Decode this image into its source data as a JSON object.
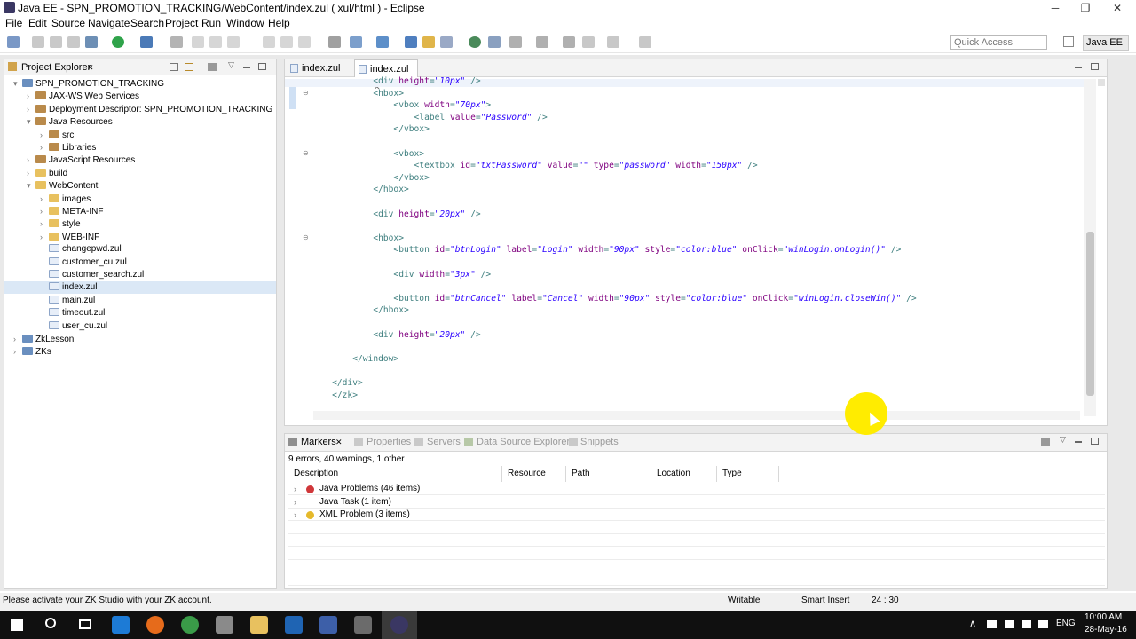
{
  "window": {
    "title": "Java EE - SPN_PROMOTION_TRACKING/WebContent/index.zul ( xul/html ) - Eclipse",
    "min": "─",
    "max": "❐",
    "close": "✕"
  },
  "menu": [
    "File",
    "Edit",
    "Source",
    "Navigate",
    "Search",
    "Project",
    "Run",
    "Window",
    "Help"
  ],
  "toolbar": {
    "quick_access_placeholder": "Quick Access",
    "perspective_label": "Java EE"
  },
  "project_explorer": {
    "tab_label": "Project Explorer",
    "close": "✕",
    "items": [
      {
        "label": "SPN_PROMOTION_TRACKING",
        "icon": "project-icon",
        "arrow": "▾"
      },
      {
        "label": "JAX-WS Web Services",
        "icon": "package-icon",
        "arrow": "›"
      },
      {
        "label": "Deployment Descriptor: SPN_PROMOTION_TRACKING",
        "icon": "package-icon",
        "arrow": "›"
      },
      {
        "label": "Java Resources",
        "icon": "package-icon",
        "arrow": "▾"
      },
      {
        "label": "src",
        "icon": "package-icon",
        "arrow": "›"
      },
      {
        "label": "Libraries",
        "icon": "package-icon",
        "arrow": "›"
      },
      {
        "label": "JavaScript Resources",
        "icon": "package-icon",
        "arrow": "›"
      },
      {
        "label": "build",
        "icon": "folder-icon",
        "arrow": "›"
      },
      {
        "label": "WebContent",
        "icon": "folder-icon",
        "arrow": "▾"
      },
      {
        "label": "images",
        "icon": "folder-icon",
        "arrow": "›"
      },
      {
        "label": "META-INF",
        "icon": "folder-icon",
        "arrow": "›"
      },
      {
        "label": "style",
        "icon": "folder-icon",
        "arrow": "›"
      },
      {
        "label": "WEB-INF",
        "icon": "folder-icon",
        "arrow": "›"
      },
      {
        "label": "changepwd.zul",
        "icon": "file-icon",
        "arrow": ""
      },
      {
        "label": "customer_cu.zul",
        "icon": "file-icon",
        "arrow": ""
      },
      {
        "label": "customer_search.zul",
        "icon": "file-icon",
        "arrow": ""
      },
      {
        "label": "index.zul",
        "icon": "file-icon",
        "arrow": ""
      },
      {
        "label": "main.zul",
        "icon": "file-icon",
        "arrow": ""
      },
      {
        "label": "timeout.zul",
        "icon": "file-icon",
        "arrow": ""
      },
      {
        "label": "user_cu.zul",
        "icon": "file-icon",
        "arrow": ""
      },
      {
        "label": "ZkLesson",
        "icon": "project-icon",
        "arrow": "›"
      },
      {
        "label": "ZKs",
        "icon": "project-icon",
        "arrow": "›"
      }
    ]
  },
  "editor": {
    "tabs": [
      {
        "label": "index.zul",
        "close": ""
      },
      {
        "label": "index.zul",
        "close": "✕"
      }
    ],
    "lines": [
      {
        "indent": "            ",
        "parts": [
          [
            "t",
            "<div "
          ],
          [
            "a",
            "height"
          ],
          [
            "t",
            "="
          ],
          [
            "v",
            "\"10px\""
          ],
          [
            "t",
            " />"
          ]
        ]
      },
      {
        "indent": "            ",
        "parts": [
          [
            "t",
            "<hbox>"
          ]
        ]
      },
      {
        "indent": "                ",
        "parts": [
          [
            "t",
            "<vbox "
          ],
          [
            "a",
            "width"
          ],
          [
            "t",
            "="
          ],
          [
            "v",
            "\"70px\""
          ],
          [
            "t",
            ">"
          ]
        ]
      },
      {
        "indent": "                    ",
        "parts": [
          [
            "t",
            "<label "
          ],
          [
            "a",
            "value"
          ],
          [
            "t",
            "="
          ],
          [
            "v",
            "\"Password\""
          ],
          [
            "t",
            " />"
          ]
        ]
      },
      {
        "indent": "                ",
        "parts": [
          [
            "t",
            "</vbox>"
          ]
        ]
      },
      {
        "indent": "",
        "parts": []
      },
      {
        "indent": "                ",
        "parts": [
          [
            "t",
            "<vbox>"
          ]
        ]
      },
      {
        "indent": "                    ",
        "parts": [
          [
            "t",
            "<textbox "
          ],
          [
            "a",
            "id"
          ],
          [
            "t",
            "="
          ],
          [
            "v",
            "\"txtPassword\""
          ],
          [
            "t",
            " "
          ],
          [
            "a",
            "value"
          ],
          [
            "t",
            "="
          ],
          [
            "v",
            "\"\""
          ],
          [
            "t",
            " "
          ],
          [
            "a",
            "type"
          ],
          [
            "t",
            "="
          ],
          [
            "v",
            "\"password\""
          ],
          [
            "t",
            " "
          ],
          [
            "a",
            "width"
          ],
          [
            "t",
            "="
          ],
          [
            "v",
            "\"150px\""
          ],
          [
            "t",
            " />"
          ]
        ]
      },
      {
        "indent": "                ",
        "parts": [
          [
            "t",
            "</vbox>"
          ]
        ]
      },
      {
        "indent": "            ",
        "parts": [
          [
            "t",
            "</hbox>"
          ]
        ]
      },
      {
        "indent": "",
        "parts": []
      },
      {
        "indent": "            ",
        "parts": [
          [
            "t",
            "<div "
          ],
          [
            "a",
            "height"
          ],
          [
            "t",
            "="
          ],
          [
            "v",
            "\"20px\""
          ],
          [
            "t",
            " />"
          ]
        ]
      },
      {
        "indent": "",
        "parts": []
      },
      {
        "indent": "            ",
        "parts": [
          [
            "t",
            "<hbox>"
          ]
        ]
      },
      {
        "indent": "                ",
        "parts": [
          [
            "t",
            "<button "
          ],
          [
            "a",
            "id"
          ],
          [
            "t",
            "="
          ],
          [
            "v",
            "\"btnLogin\""
          ],
          [
            "t",
            " "
          ],
          [
            "a",
            "label"
          ],
          [
            "t",
            "="
          ],
          [
            "v",
            "\"Login\""
          ],
          [
            "t",
            " "
          ],
          [
            "a",
            "width"
          ],
          [
            "t",
            "="
          ],
          [
            "v",
            "\"90px\""
          ],
          [
            "t",
            " "
          ],
          [
            "a",
            "style"
          ],
          [
            "t",
            "="
          ],
          [
            "v",
            "\"color:blue\""
          ],
          [
            "t",
            " "
          ],
          [
            "a",
            "onClick"
          ],
          [
            "t",
            "="
          ],
          [
            "v",
            "\"winLogin.onLogin()\""
          ],
          [
            "t",
            " />"
          ]
        ]
      },
      {
        "indent": "",
        "parts": []
      },
      {
        "indent": "                ",
        "parts": [
          [
            "t",
            "<div "
          ],
          [
            "a",
            "width"
          ],
          [
            "t",
            "="
          ],
          [
            "v",
            "\"3px\""
          ],
          [
            "t",
            " />"
          ]
        ]
      },
      {
        "indent": "",
        "parts": []
      },
      {
        "indent": "                ",
        "parts": [
          [
            "t",
            "<button "
          ],
          [
            "a",
            "id"
          ],
          [
            "t",
            "="
          ],
          [
            "v",
            "\"btnCancel\""
          ],
          [
            "t",
            " "
          ],
          [
            "a",
            "label"
          ],
          [
            "t",
            "="
          ],
          [
            "v",
            "\"Cancel\""
          ],
          [
            "t",
            " "
          ],
          [
            "a",
            "width"
          ],
          [
            "t",
            "="
          ],
          [
            "v",
            "\"90px\""
          ],
          [
            "t",
            " "
          ],
          [
            "a",
            "style"
          ],
          [
            "t",
            "="
          ],
          [
            "v",
            "\"color:blue\""
          ],
          [
            "t",
            " "
          ],
          [
            "a",
            "onClick"
          ],
          [
            "t",
            "="
          ],
          [
            "v",
            "\"winLogin.closeWin()\""
          ],
          [
            "t",
            " />"
          ]
        ]
      },
      {
        "indent": "            ",
        "parts": [
          [
            "t",
            "</hbox>"
          ]
        ]
      },
      {
        "indent": "",
        "parts": []
      },
      {
        "indent": "            ",
        "parts": [
          [
            "t",
            "<div "
          ],
          [
            "a",
            "height"
          ],
          [
            "t",
            "="
          ],
          [
            "v",
            "\"20px\""
          ],
          [
            "t",
            " />"
          ]
        ]
      },
      {
        "indent": "",
        "parts": []
      },
      {
        "indent": "        ",
        "parts": [
          [
            "t",
            "</window>"
          ]
        ]
      },
      {
        "indent": "",
        "parts": []
      },
      {
        "indent": "    ",
        "parts": [
          [
            "t",
            "</div>"
          ]
        ]
      },
      {
        "indent": "    ",
        "parts": [
          [
            "t",
            "</zk>"
          ]
        ]
      }
    ]
  },
  "markers": {
    "tabs": [
      "Markers",
      "Properties",
      "Servers",
      "Data Source Explorer",
      "Snippets"
    ],
    "summary": "9 errors, 40 warnings, 1 other",
    "columns": [
      "Description",
      "Resource",
      "Path",
      "Location",
      "Type"
    ],
    "rows": [
      {
        "label": "Java Problems (46 items)",
        "icon": "error-icon"
      },
      {
        "label": "Java Task (1 item)",
        "icon": "task-icon"
      },
      {
        "label": "XML Problem (3 items)",
        "icon": "warning-icon"
      }
    ]
  },
  "status": {
    "message": "Please activate your ZK Studio with your ZK account.",
    "writable": "Writable",
    "insert_mode": "Smart Insert",
    "position": "24 : 30"
  },
  "taskbar": {
    "time": "10:00 AM",
    "date": "28-May-16",
    "lang": "ENG"
  },
  "colors": {
    "tag": "#3f7f7f",
    "attribute": "#7f007f",
    "value": "#2a00ff",
    "cursor_highlight": "#ffec00"
  }
}
